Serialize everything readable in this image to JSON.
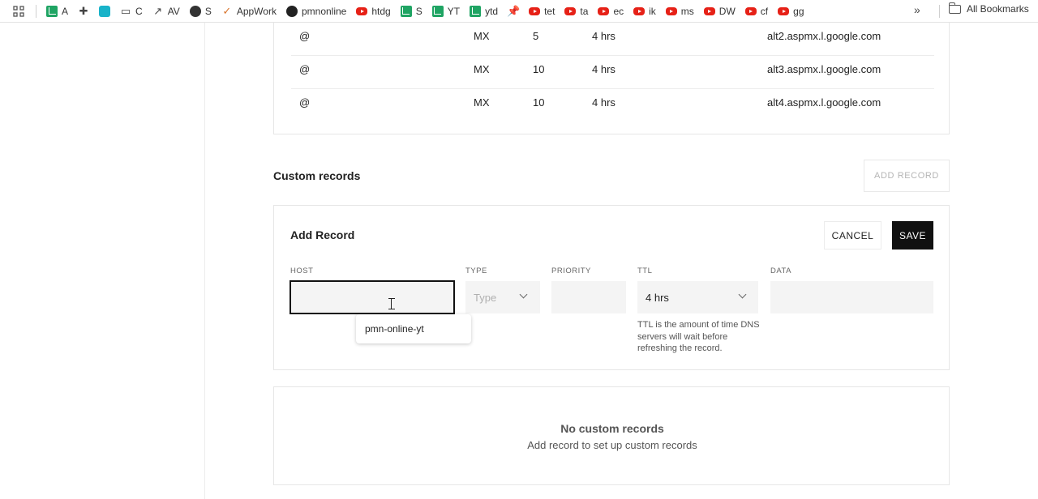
{
  "bookmarks": {
    "items": [
      {
        "label": "A",
        "icon": "sheets-icon"
      },
      {
        "label": "",
        "icon": "puzzle-icon"
      },
      {
        "label": "",
        "icon": "app-icon"
      },
      {
        "label": "C",
        "icon": "folder-icon"
      },
      {
        "label": "AV",
        "icon": "trend-icon"
      },
      {
        "label": "S",
        "icon": "globe-icon"
      },
      {
        "label": "AppWork",
        "icon": "check-icon"
      },
      {
        "label": "pmnonline",
        "icon": "github-icon"
      },
      {
        "label": "htdg",
        "icon": "youtube-icon"
      },
      {
        "label": "S",
        "icon": "sheets-icon"
      },
      {
        "label": "YT",
        "icon": "sheets-icon"
      },
      {
        "label": "ytd",
        "icon": "sheets-icon"
      },
      {
        "label": "",
        "icon": "pin-icon"
      },
      {
        "label": "tet",
        "icon": "youtube-icon"
      },
      {
        "label": "ta",
        "icon": "youtube-icon"
      },
      {
        "label": "ec",
        "icon": "youtube-icon"
      },
      {
        "label": "ik",
        "icon": "youtube-icon"
      },
      {
        "label": "ms",
        "icon": "youtube-icon"
      },
      {
        "label": "DW",
        "icon": "youtube-icon"
      },
      {
        "label": "cf",
        "icon": "youtube-icon"
      },
      {
        "label": "gg",
        "icon": "youtube-icon"
      }
    ],
    "more": "»",
    "all_bookmarks": "All Bookmarks"
  },
  "mx_records": [
    {
      "host": "@",
      "type": "MX",
      "priority": "5",
      "ttl": "4 hrs",
      "data": "alt2.aspmx.l.google.com"
    },
    {
      "host": "@",
      "type": "MX",
      "priority": "10",
      "ttl": "4 hrs",
      "data": "alt3.aspmx.l.google.com"
    },
    {
      "host": "@",
      "type": "MX",
      "priority": "10",
      "ttl": "4 hrs",
      "data": "alt4.aspmx.l.google.com"
    }
  ],
  "custom": {
    "title": "Custom records",
    "add_record_button": "ADD RECORD"
  },
  "add_form": {
    "title": "Add Record",
    "cancel": "CANCEL",
    "save": "SAVE",
    "labels": {
      "host": "HOST",
      "type": "TYPE",
      "priority": "PRIORITY",
      "ttl": "TTL",
      "data": "DATA"
    },
    "host_value": "",
    "type_placeholder": "Type",
    "ttl_value": "4 hrs",
    "ttl_help": "TTL is the amount of time DNS servers will wait before refreshing the record.",
    "autocomplete_suggestion": "pmn-online-yt"
  },
  "empty": {
    "title": "No custom records",
    "subtitle": "Add record to set up custom records"
  },
  "colors": {
    "save_bg": "#111111",
    "youtube": "#e62117",
    "sheets": "#1fa463"
  }
}
